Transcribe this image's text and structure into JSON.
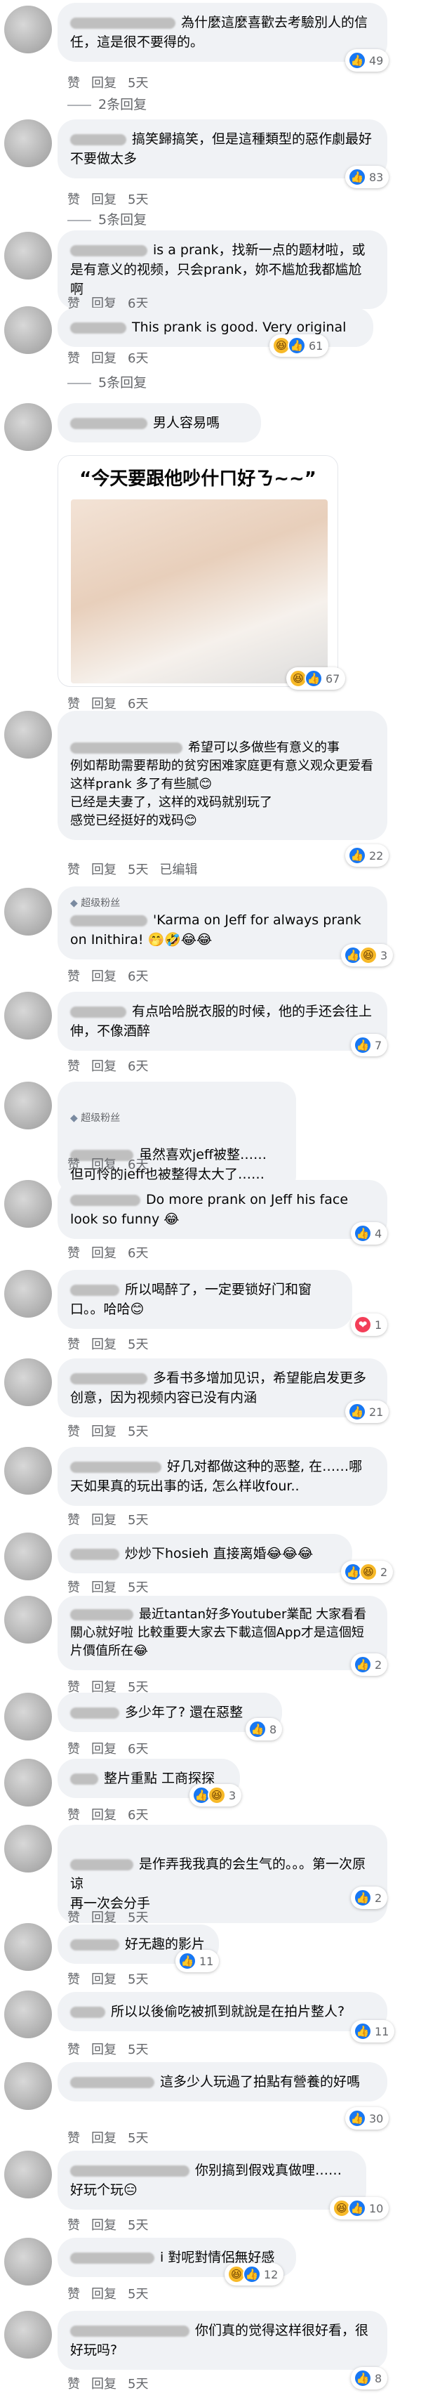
{
  "actions": {
    "like": "赞",
    "reply": "回复"
  },
  "comments": [
    {
      "text": "為什麼這麼喜歡去考驗別人的信任，這是很不要得的。",
      "time": "5天",
      "reactions": [
        "like"
      ],
      "count": "49",
      "replies": "2条回复"
    },
    {
      "text": "搞笑歸搞笑，但是這種類型的惡作劇最好不要做太多",
      "time": "5天",
      "reactions": [
        "like"
      ],
      "count": "83",
      "replies": "5条回复"
    },
    {
      "text": "is a prank，找新一点的题材啦，或是有意义的视频，只会prank，妳不尴尬我都尴尬啊",
      "time": "6天"
    },
    {
      "text": "This prank is good. Very original",
      "time": "6天",
      "reactions": [
        "haha",
        "like"
      ],
      "count": "61",
      "replies": "5条回复"
    },
    {
      "text": "男人容易嗎",
      "meme_caption": "“今天要跟他吵什ㄇ好ㄋ~~”",
      "time": "6天",
      "reactions": [
        "haha",
        "like"
      ],
      "count": "67"
    },
    {
      "text": "希望可以多做些有意义的事\n例如帮助需要帮助的贫穷困难家庭更有意义观众更爱看\n这样prank 多了有些腻😊\n已经是夫妻了，这样的戏码就别玩了\n感觉已经挺好的戏码😊",
      "time": "5天",
      "edited": "已编辑",
      "reactions": [
        "like"
      ],
      "count": "22"
    },
    {
      "badge": "超级粉丝",
      "text": "'Karma on Jeff for always prank on Inithira! 🤭🤣😂😂",
      "time": "6天",
      "reactions": [
        "like",
        "haha"
      ],
      "count": "3"
    },
    {
      "text": "有点哈哈脱衣服的时候，他的手还会往上伸，不像酒醉",
      "time": "6天",
      "reactions": [
        "like"
      ],
      "count": "7"
    },
    {
      "badge": "超级粉丝",
      "text": "虽然喜欢jeff被整……\n但可怜的jeff也被整得太大了……",
      "time": "6天"
    },
    {
      "text": "Do more prank on Jeff his face look so funny 😂",
      "time": "6天",
      "reactions": [
        "like"
      ],
      "count": "4"
    },
    {
      "text": "所以喝醉了，一定要锁好门和窗口。。哈哈😊",
      "time": "5天",
      "reactions": [
        "love"
      ],
      "count": "1"
    },
    {
      "text": "多看书多增加见识，希望能启发更多创意，因为视频内容已没有内涵",
      "time": "5天",
      "reactions": [
        "like"
      ],
      "count": "21"
    },
    {
      "text": "好几对都做这种的恶整, 在……哪天如果真的玩出事的话, 怎么样收four..",
      "time": "5天"
    },
    {
      "text": "炒炒下hosieh 直接离婚😂😂😂",
      "time": "5天",
      "reactions": [
        "like",
        "haha"
      ],
      "count": "2"
    },
    {
      "text": "最近tantan好多Youtuber業配 大家看看關心就好啦 比較重要大家去下載這個App才是這個短片價值所在😂",
      "time": "5天",
      "reactions": [
        "like"
      ],
      "count": "2"
    },
    {
      "text": "多少年了? 還在惡整",
      "time": "6天",
      "reactions": [
        "like"
      ],
      "count": "8"
    },
    {
      "text": "整片重點 工商探探",
      "time": "6天",
      "reactions": [
        "like",
        "haha"
      ],
      "count": "3"
    },
    {
      "text": "是作弄我我真的会生气的。。。第一次原谅\n再一次会分手",
      "time": "5天",
      "reactions": [
        "like"
      ],
      "count": "2"
    },
    {
      "text": "好无趣的影片",
      "time": "5天",
      "reactions": [
        "like"
      ],
      "count": "11"
    },
    {
      "text": "所以以後偷吃被抓到就說是在拍片整人?",
      "time": "5天",
      "reactions": [
        "like"
      ],
      "count": "11"
    },
    {
      "text": "這多少人玩過了拍點有營養的好嗎",
      "time": "5天",
      "reactions": [
        "like"
      ],
      "count": "30"
    },
    {
      "text": "你别搞到假戏真做哩……好玩个玩😑",
      "time": "5天",
      "reactions": [
        "haha",
        "like"
      ],
      "count": "10"
    },
    {
      "text": "i 對呢對情侶無好感",
      "time": "5天",
      "reactions": [
        "haha",
        "like"
      ],
      "count": "12"
    },
    {
      "text": "你们真的觉得这样很好看，很好玩吗?",
      "time": "5天",
      "reactions": [
        "like"
      ],
      "count": "8"
    }
  ]
}
